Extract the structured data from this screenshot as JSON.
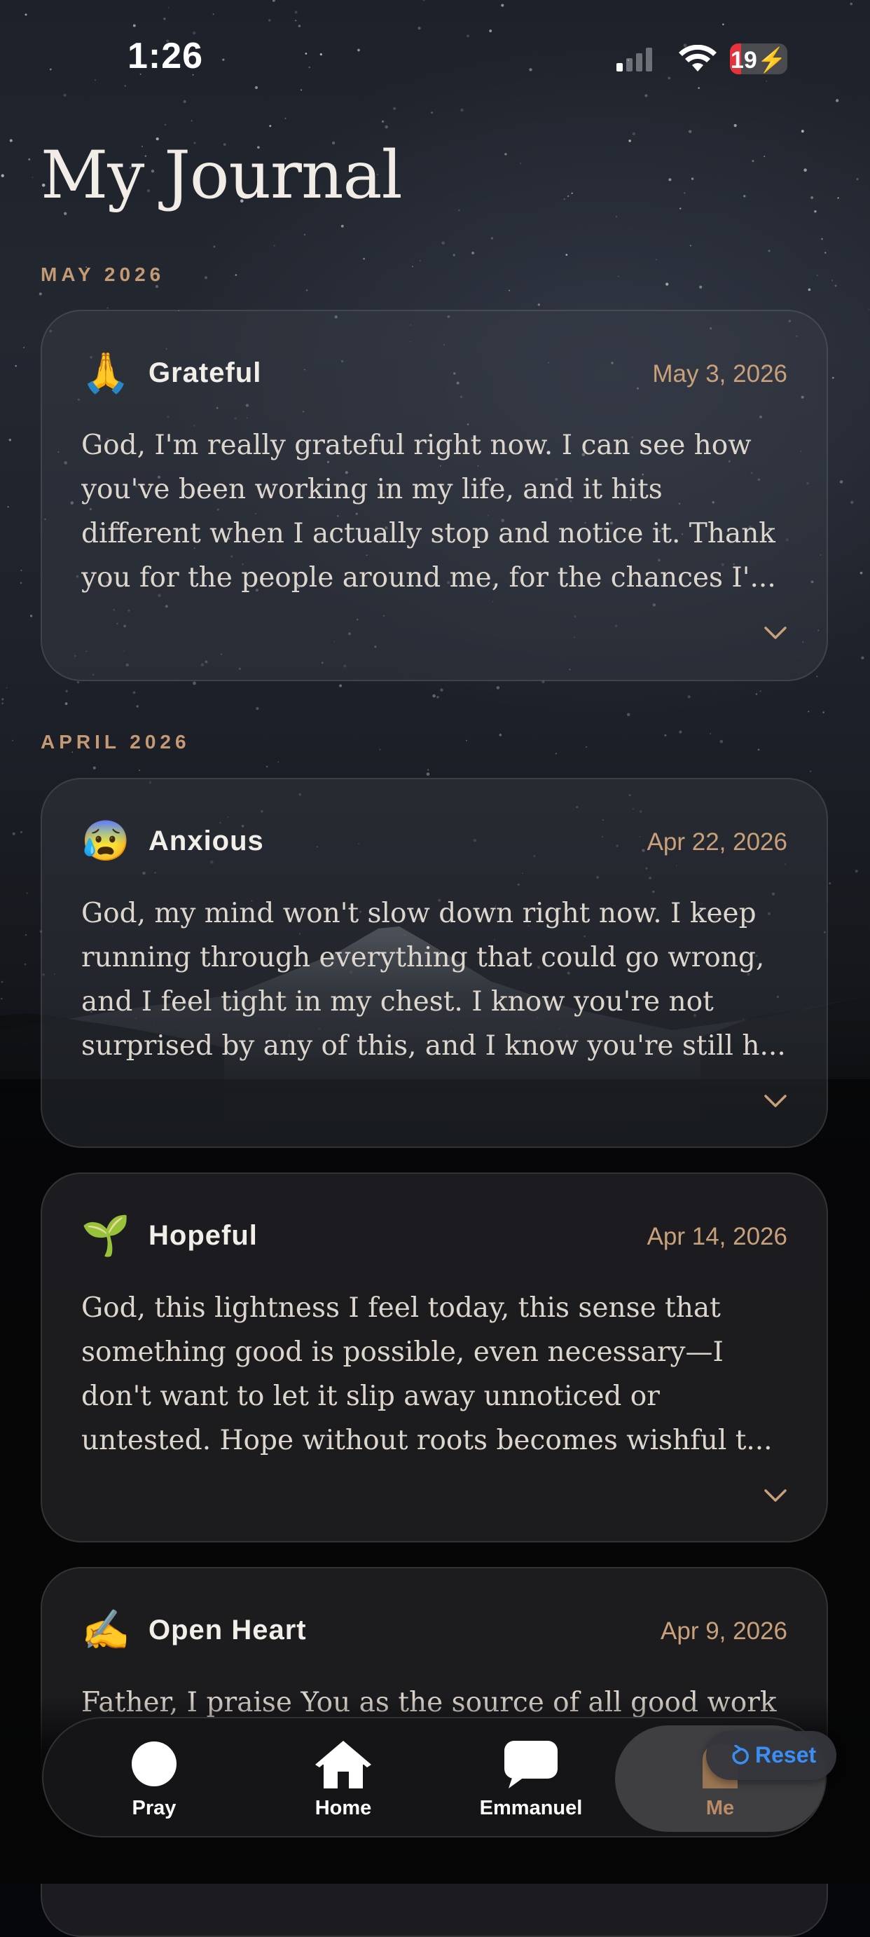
{
  "status_bar": {
    "time": "1:26",
    "battery_level": "19",
    "battery_icon": "battery-charging-icon",
    "wifi_icon": "wifi-icon",
    "signal_icon": "cellular-signal-icon"
  },
  "page": {
    "title": "My Journal"
  },
  "sections": [
    {
      "label": "MAY 2026",
      "entries": [
        {
          "emoji": "🙏",
          "mood": "Grateful",
          "date": "May 3, 2026",
          "body": "God, I'm really grateful right now. I can see how you've been working in my life, and it hits different when I actually stop and notice it. Thank you for the people around me, for the chances I'..."
        }
      ]
    },
    {
      "label": "APRIL 2026",
      "entries": [
        {
          "emoji": "😰",
          "mood": "Anxious",
          "date": "Apr 22, 2026",
          "body": "God, my mind won't slow down right now. I keep running through everything that could go wrong, and I feel tight in my chest. I know you're not surprised by any of this, and I know you're still h..."
        },
        {
          "emoji": "🌱",
          "mood": "Hopeful",
          "date": "Apr 14, 2026",
          "body": "God, this lightness I feel today, this sense that something good is possible, even necessary—I don't want to let it slip away unnoticed or untested. Hope without roots becomes wishful t..."
        },
        {
          "emoji": "✍️",
          "mood": "Open Heart",
          "date": "Apr 9, 2026",
          "body": "Father, I praise You as the source of all good work"
        }
      ]
    }
  ],
  "tab_bar": {
    "tabs": [
      {
        "label": "Pray",
        "icon": "circle-icon"
      },
      {
        "label": "Home",
        "icon": "house-icon"
      },
      {
        "label": "Emmanuel",
        "icon": "chat-bubble-icon"
      },
      {
        "label": "Me",
        "icon": "person-icon",
        "active": true
      }
    ],
    "reset_label": "Reset",
    "reset_icon": "reset-arrow-icon"
  },
  "colors": {
    "accent": "#c8a07a",
    "reset_blue": "#3b8ff4",
    "battery_red": "#e5323b"
  }
}
